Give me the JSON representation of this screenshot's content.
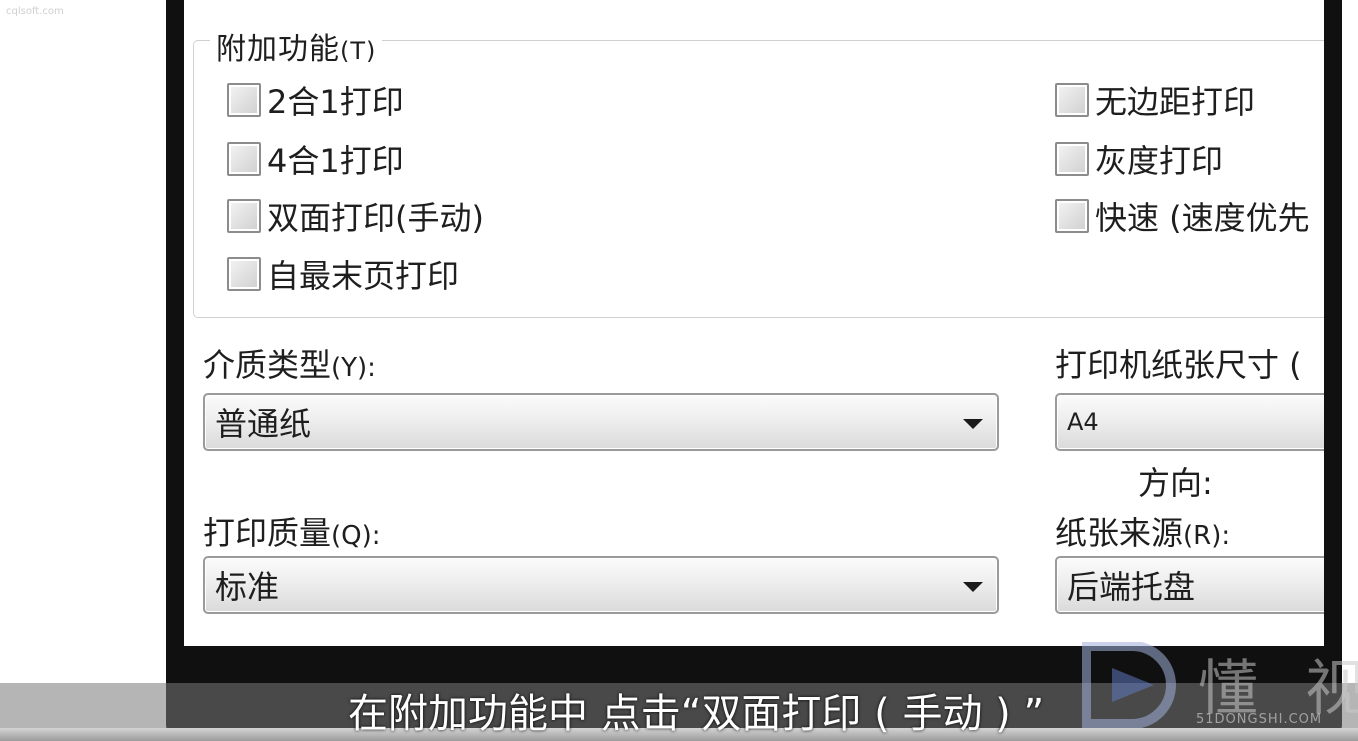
{
  "watermark_top": "cqlsoft.com",
  "dialog": {
    "group": {
      "title": "附加功能",
      "hotkey": "(T)",
      "options_left": [
        {
          "label": "2合1打印",
          "checked": false
        },
        {
          "label": "4合1打印",
          "checked": false
        },
        {
          "label": "双面打印(手动)",
          "checked": false
        },
        {
          "label": "自最末页打印",
          "checked": false
        }
      ],
      "options_right": [
        {
          "label": "无边距打印",
          "checked": false
        },
        {
          "label": "灰度打印",
          "checked": false
        },
        {
          "label": "快速 (速度优先",
          "checked": false
        }
      ]
    },
    "media_type": {
      "label": "介质类型",
      "hotkey": "(Y):",
      "value": "普通纸"
    },
    "paper_size": {
      "label": "打印机纸张尺寸 (",
      "value": "A4"
    },
    "orientation": {
      "label": "方向:"
    },
    "print_quality": {
      "label": "打印质量",
      "hotkey": "(Q):",
      "value": "标准"
    },
    "paper_source": {
      "label": "纸张来源",
      "hotkey": "(R):",
      "value": "后端托盘"
    }
  },
  "subtitle": "在附加功能中 点击“双面打印 ( 手动 ) ”",
  "brand": {
    "name": "懂 视",
    "url": "51DONGSHI.COM",
    "color": "#9fb0d8"
  },
  "colors": {
    "frame": "#101010",
    "checkbox_border": "#8c8c8c",
    "combo_border": "#9a9a9a"
  }
}
